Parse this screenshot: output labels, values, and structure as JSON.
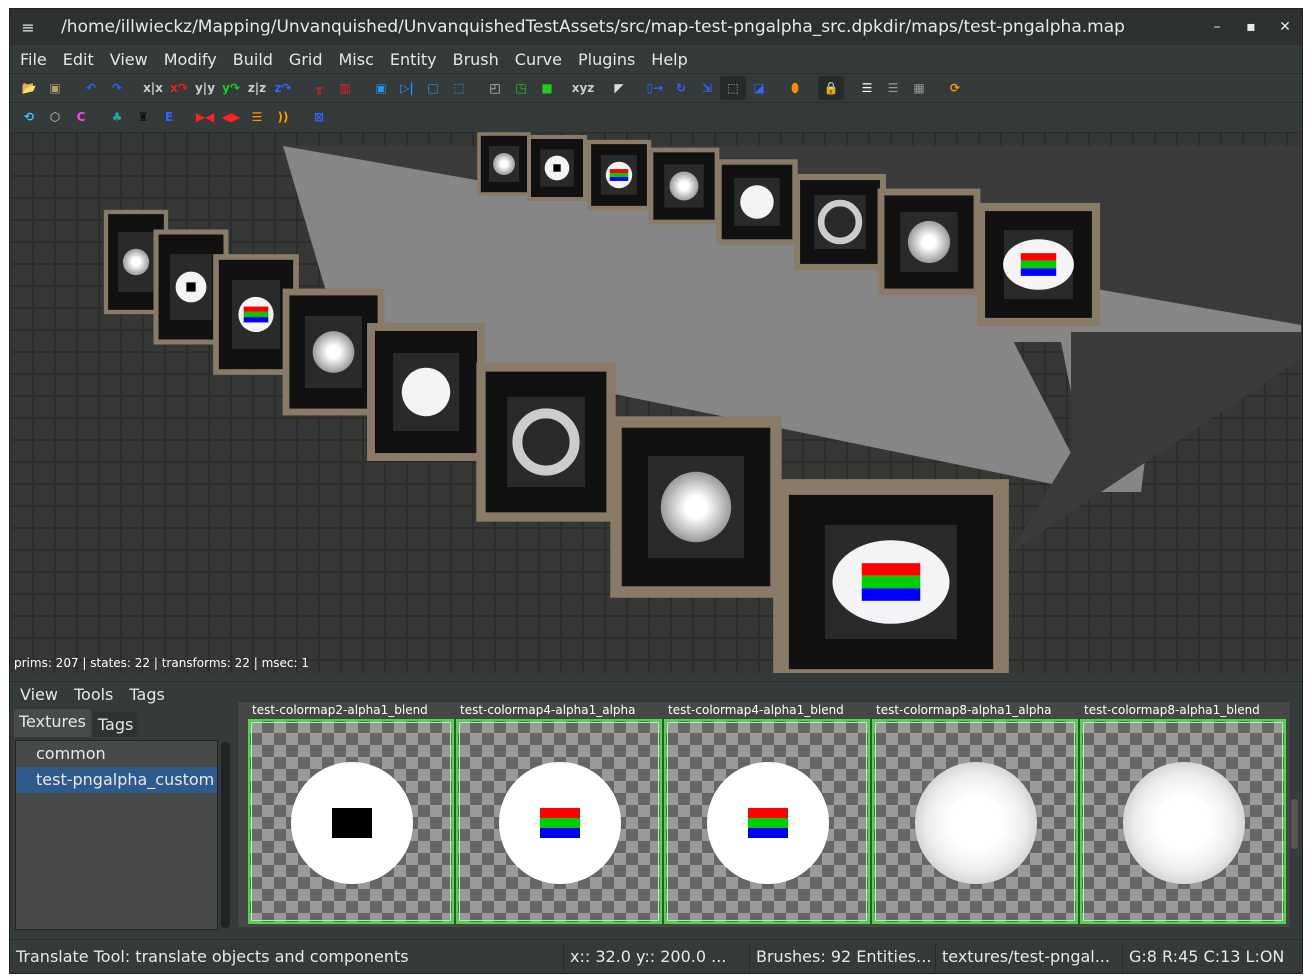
{
  "window": {
    "title": "/home/illwieckz/Mapping/Unvanquished/UnvanquishedTestAssets/src/map-test-pngalpha_src.dpkdir/maps/test-pngalpha.map",
    "menu_icon": "≡",
    "minimize": "–",
    "maximize": "▪",
    "close": "✕"
  },
  "menubar": [
    "File",
    "Edit",
    "View",
    "Modify",
    "Build",
    "Grid",
    "Misc",
    "Entity",
    "Brush",
    "Curve",
    "Plugins",
    "Help"
  ],
  "toolbar1": [
    {
      "name": "open-icon",
      "g": "📂",
      "c": "#ee0"
    },
    {
      "name": "save-icon",
      "g": "▣",
      "c": "#aa6"
    },
    {
      "sep": 1
    },
    {
      "name": "undo-icon",
      "g": "↶",
      "c": "#26f"
    },
    {
      "name": "redo-icon",
      "g": "↷",
      "c": "#26f"
    },
    {
      "sep": 1
    },
    {
      "name": "flip-x-icon",
      "g": "x|x",
      "c": "#ccc"
    },
    {
      "name": "rotate-x-icon",
      "g": "x↷",
      "c": "#e22"
    },
    {
      "name": "flip-y-icon",
      "g": "y|y",
      "c": "#ccc"
    },
    {
      "name": "rotate-y-icon",
      "g": "y↷",
      "c": "#2c2"
    },
    {
      "name": "flip-z-icon",
      "g": "z|z",
      "c": "#ccc"
    },
    {
      "name": "rotate-z-icon",
      "g": "z↷",
      "c": "#36f"
    },
    {
      "sep": 1
    },
    {
      "name": "csg-subtract-icon",
      "g": "╥",
      "c": "#e22"
    },
    {
      "name": "csg-merge-icon",
      "g": "▥",
      "c": "#e22"
    },
    {
      "sep": 1
    },
    {
      "name": "select-inside-icon",
      "g": "▣",
      "c": "#29f"
    },
    {
      "name": "select-touching-icon",
      "g": "▷|",
      "c": "#29f"
    },
    {
      "name": "select-complete-icon",
      "g": "□",
      "c": "#29f"
    },
    {
      "name": "select-partial-icon",
      "g": "⬚",
      "c": "#29f"
    },
    {
      "sep": 1
    },
    {
      "name": "view-top-icon",
      "g": "◰",
      "c": "#ccc"
    },
    {
      "name": "view-side-icon",
      "g": "◳",
      "c": "#2c2"
    },
    {
      "name": "view-front-icon",
      "g": "■",
      "c": "#2c2"
    },
    {
      "sep": 1
    },
    {
      "name": "view-xyz-icon",
      "g": "xyz",
      "c": "#ccc"
    },
    {
      "sep": 1
    },
    {
      "name": "clipper-icon",
      "g": "◤",
      "c": "#ddd"
    },
    {
      "sep": 1
    },
    {
      "name": "translate-icon",
      "g": "▯→",
      "c": "#36f"
    },
    {
      "name": "rotate-icon",
      "g": "↻",
      "c": "#36f"
    },
    {
      "name": "scale-icon",
      "g": "⇲",
      "c": "#36f"
    },
    {
      "name": "drag-icon",
      "g": "⬚",
      "c": "#aaa",
      "on": true
    },
    {
      "name": "resize-icon",
      "g": "◪",
      "c": "#36f"
    },
    {
      "sep": 1
    },
    {
      "name": "cylinder-icon",
      "g": "⬮",
      "c": "#f80"
    },
    {
      "sep": 1
    },
    {
      "name": "lock-icon",
      "g": "🔒",
      "c": "#ee0",
      "on": true
    },
    {
      "sep": 1
    },
    {
      "name": "entity-list-icon",
      "g": "☰",
      "c": "#fff"
    },
    {
      "name": "console-icon",
      "g": "☰",
      "c": "#999"
    },
    {
      "name": "texture-browser-icon",
      "g": "▦",
      "c": "#999"
    },
    {
      "sep": 1
    },
    {
      "name": "refresh-icon",
      "g": "⟳",
      "c": "#f90"
    }
  ],
  "toolbar2": [
    {
      "name": "cycle-icon",
      "g": "⟲",
      "c": "#3cf"
    },
    {
      "name": "patch-icon",
      "g": "⬡",
      "c": "#ccc"
    },
    {
      "name": "caulk-icon",
      "g": "C",
      "c": "#f4f"
    },
    {
      "sep": 1
    },
    {
      "name": "tree-icon",
      "g": "♣",
      "c": "#2aa"
    },
    {
      "name": "train-icon",
      "g": "♜",
      "c": "#111"
    },
    {
      "name": "entity-icon",
      "g": "E",
      "c": "#36f"
    },
    {
      "sep": 1
    },
    {
      "name": "mirror-icon",
      "g": "▶◀",
      "c": "#f22"
    },
    {
      "name": "split-icon",
      "g": "◀▶",
      "c": "#f22"
    },
    {
      "name": "bevel-icon",
      "g": "☰",
      "c": "#f90"
    },
    {
      "name": "cone-icon",
      "g": "))",
      "c": "#f90"
    },
    {
      "sep": 1
    },
    {
      "name": "filter-icon",
      "g": "⊠",
      "c": "#36f"
    }
  ],
  "viewport": {
    "stats": "prims: 207 | states: 22 | transforms: 22 | msec: 1"
  },
  "texture_browser": {
    "menu": [
      "View",
      "Tools",
      "Tags"
    ],
    "tabs": [
      "Textures",
      "Tags"
    ],
    "folders": [
      "common",
      "test-pngalpha_custom"
    ],
    "selected_folder": "test-pngalpha_custom",
    "textures": [
      {
        "name": "test-colormap2-alpha1_blend",
        "kind": "black"
      },
      {
        "name": "test-colormap4-alpha1_alpha",
        "kind": "rgb"
      },
      {
        "name": "test-colormap4-alpha1_blend",
        "kind": "rgb"
      },
      {
        "name": "test-colormap8-alpha1_alpha",
        "kind": "soft"
      },
      {
        "name": "test-colormap8-alpha1_blend",
        "kind": "soft"
      }
    ]
  },
  "statusbar": {
    "message": "Translate Tool: translate objects and components",
    "coords": "x::   32.0  y::  200.0 ...",
    "counts": "Brushes: 92 Entities...",
    "texture": "textures/test-pngal...",
    "grid": "G:8  R:45  C:13  L:ON"
  }
}
